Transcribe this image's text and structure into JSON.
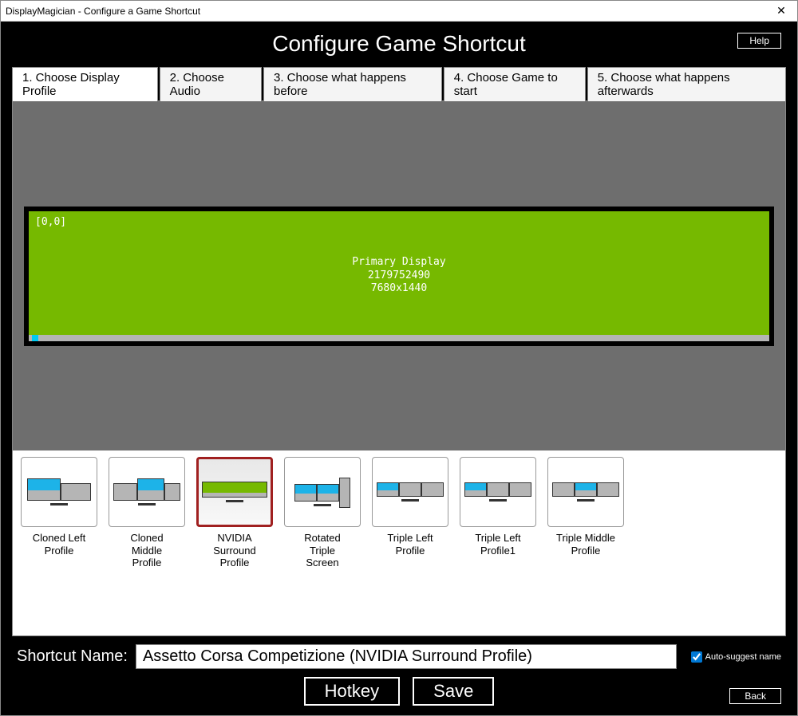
{
  "window": {
    "title": "DisplayMagician - Configure a Game Shortcut"
  },
  "header": {
    "title": "Configure Game Shortcut",
    "help_label": "Help"
  },
  "tabs": [
    "1. Choose Display Profile",
    "2. Choose Audio",
    "3. Choose what happens before",
    "4. Choose Game to start",
    "5. Choose what happens afterwards"
  ],
  "active_tab": 0,
  "preview": {
    "coord": "[0,0]",
    "name": "Primary Display",
    "id": "2179752490",
    "resolution": "7680x1440"
  },
  "profiles": [
    {
      "label": "Cloned Left\nProfile",
      "type": "cloned-left"
    },
    {
      "label": "Cloned\nMiddle\nProfile",
      "type": "cloned-middle"
    },
    {
      "label": "NVIDIA\nSurround\nProfile",
      "type": "nvidia",
      "selected": true
    },
    {
      "label": "Rotated\nTriple\nScreen",
      "type": "rotated"
    },
    {
      "label": "Triple Left\nProfile",
      "type": "triple-left"
    },
    {
      "label": "Triple Left\nProfile1",
      "type": "triple-left1"
    },
    {
      "label": "Triple Middle\nProfile",
      "type": "triple-middle"
    }
  ],
  "bottom": {
    "shortcut_label": "Shortcut Name:",
    "shortcut_value": "Assetto Corsa Competizione (NVIDIA Surround Profile)",
    "auto_suggest_label": "Auto-suggest name",
    "auto_suggest_checked": true,
    "hotkey_label": "Hotkey",
    "save_label": "Save",
    "back_label": "Back"
  }
}
